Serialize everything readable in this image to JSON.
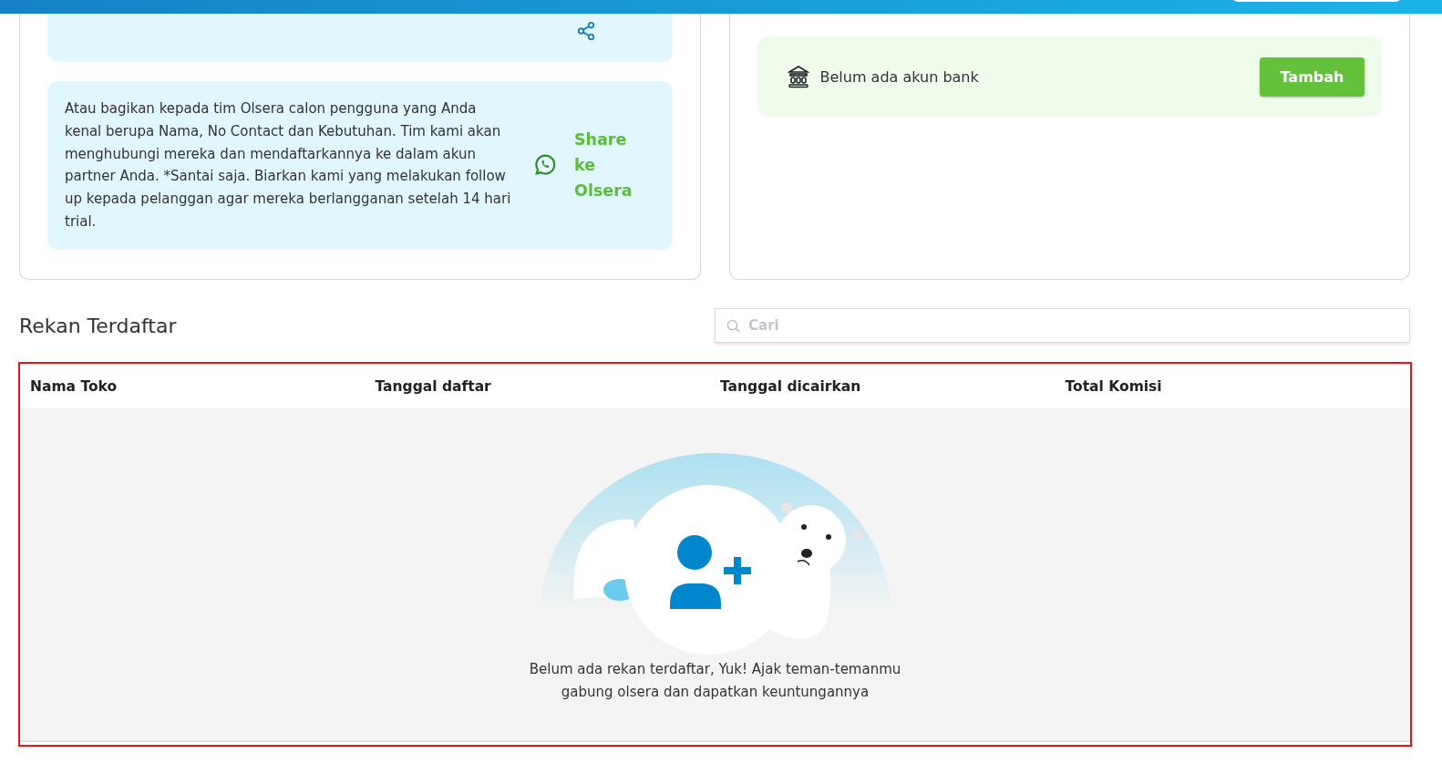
{
  "referral_card": {
    "info_text": "Atau bagikan kepada tim Olsera calon pengguna yang Anda kenal berupa Nama, No Contact dan Kebutuhan. Tim kami akan menghubungi mereka dan mendaftarkannya ke dalam akun partner Anda. *Santai saja. Biarkan kami yang melakukan follow up kepada pelanggan agar mereka berlangganan setelah 14 hari trial.",
    "share_link": "Share ke Olsera"
  },
  "bank_card": {
    "message": "Belum ada akun bank",
    "add_button": "Tambah"
  },
  "section_title": "Rekan Terdaftar",
  "search": {
    "placeholder": "Cari"
  },
  "table": {
    "columns": [
      "Nama Toko",
      "Tanggal daftar",
      "Tanggal dicairkan",
      "Total Komisi"
    ],
    "empty_message": "Belum ada rekan terdaftar, Yuk! Ajak teman-temanmu gabung olsera dan dapatkan keuntungannya"
  }
}
